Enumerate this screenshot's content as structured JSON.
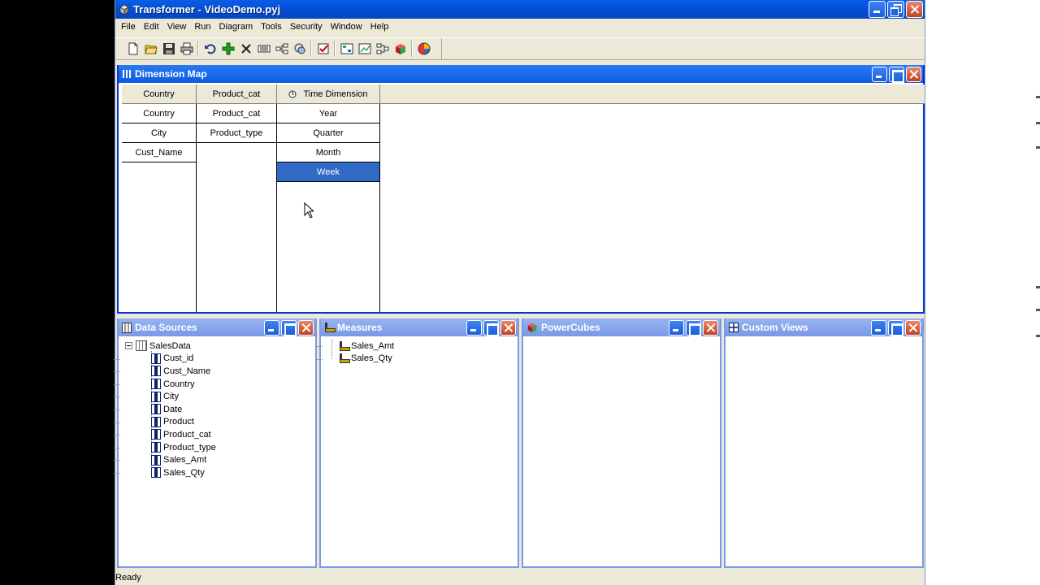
{
  "window": {
    "title": "Transformer - VideoDemo.pyj"
  },
  "menu": [
    "File",
    "Edit",
    "View",
    "Run",
    "Diagram",
    "Tools",
    "Security",
    "Window",
    "Help"
  ],
  "toolbar": {
    "icons": [
      "new-file-icon",
      "open-folder-icon",
      "save-icon",
      "print-icon",
      "undo-icon",
      "insert-icon",
      "delete-icon",
      "properties-icon",
      "diagram-icon",
      "show-scope-icon",
      "check-model-icon",
      "generate-categories-icon",
      "show-counts-icon",
      "drill-icon",
      "create-cube-icon",
      "powerplay-icon"
    ]
  },
  "dimension_map": {
    "title": "Dimension Map",
    "columns": [
      {
        "header": "Country",
        "levels": [
          "Country",
          "City",
          "Cust_Name"
        ]
      },
      {
        "header": "Product_cat",
        "levels": [
          "Product_cat",
          "Product_type"
        ]
      },
      {
        "header": "Time Dimension",
        "levels": [
          "Year",
          "Quarter",
          "Month",
          "Week"
        ],
        "selected": "Week"
      }
    ]
  },
  "data_sources": {
    "title": "Data Sources",
    "root": "SalesData",
    "columns": [
      "Cust_id",
      "Cust_Name",
      "Country",
      "City",
      "Date",
      "Product",
      "Product_cat",
      "Product_type",
      "Sales_Amt",
      "Sales_Qty"
    ]
  },
  "measures": {
    "title": "Measures",
    "items": [
      "Sales_Amt",
      "Sales_Qty"
    ]
  },
  "powercubes": {
    "title": "PowerCubes"
  },
  "custom_views": {
    "title": "Custom Views"
  },
  "status": {
    "text": "Ready"
  },
  "colors": {
    "title_bar": "#0550d6",
    "selection": "#316ac5",
    "pane_title": "#7a99e6"
  }
}
